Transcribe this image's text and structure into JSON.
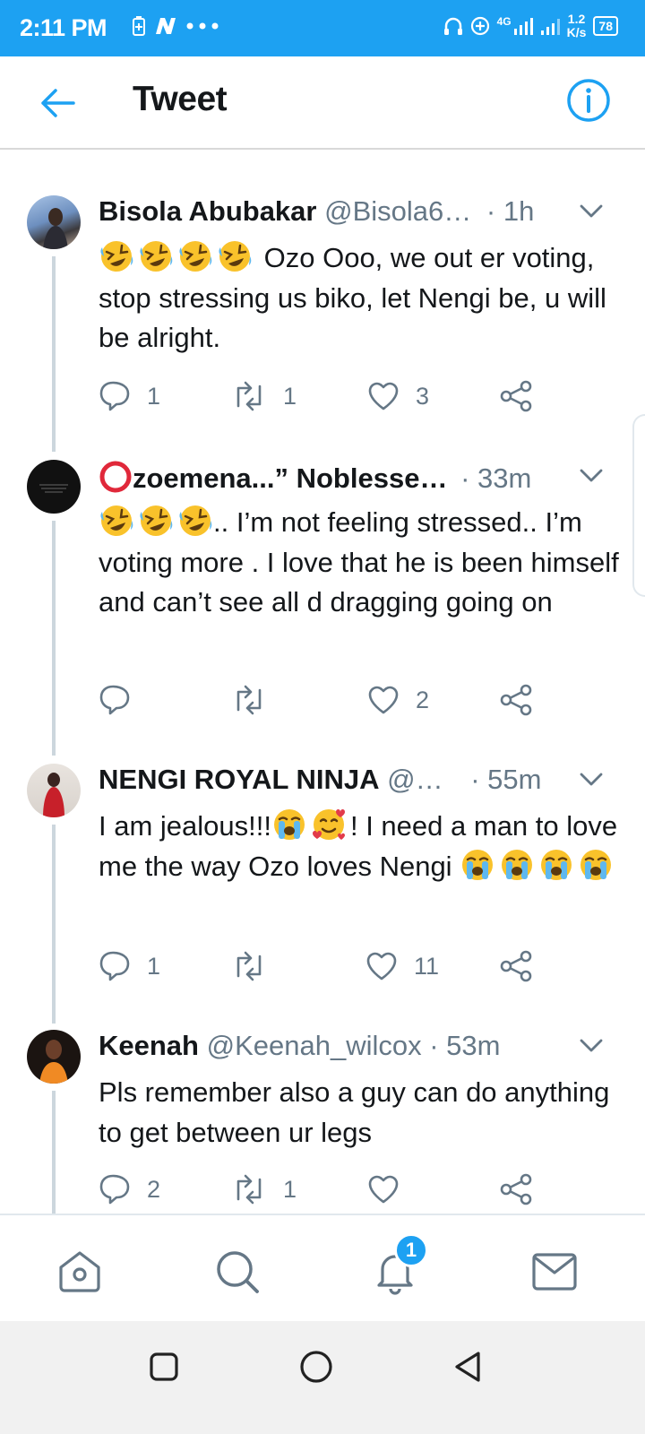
{
  "status_bar": {
    "time": "2:11 PM",
    "network": "4G",
    "speed_value": "1.2",
    "speed_unit": "K/s",
    "battery": "78"
  },
  "header": {
    "title": "Tweet"
  },
  "tweets": [
    {
      "name": "Bisola Abubakar",
      "handle": "@Bisola6…",
      "time": "· 1h",
      "emoji": [
        "rofl",
        "rofl",
        "rofl",
        "rofl"
      ],
      "text_line1": "Ozo Ooo, we out er",
      "text_rest": "voting, stop stressing us biko, let Nengi be, u will be alright.",
      "replies": "1",
      "retweets": "1",
      "likes": "3"
    },
    {
      "name_prefix": "⭕",
      "name": "zoemena...” Noblesse…",
      "handle": "",
      "time": "· 33m",
      "emoji": [
        "rofl",
        "rofl",
        "rofl"
      ],
      "text_line1": ".. I’m not feeling stressed..",
      "text_rest": "I’m voting more . I love that he is been himself and can’t see all d dragging going on",
      "replies": "",
      "retweets": "",
      "likes": "2"
    },
    {
      "name": "NENGI ROYAL NINJA",
      "handle": "@…",
      "time": "· 55m",
      "text_a": "I am jealous!!!",
      "text_b": "! I need a man to love me the way Ozo loves Nengi",
      "replies": "1",
      "retweets": "",
      "likes": "11"
    },
    {
      "name": "Keenah",
      "handle": "@Keenah_wilcox",
      "time": "· 53m",
      "text": "Pls remember also a guy can do anything to get between ur legs",
      "replies": "2",
      "retweets": "1",
      "likes": ""
    }
  ],
  "bottom_nav": {
    "items": [
      "home",
      "search",
      "notifications",
      "messages"
    ],
    "notification_badge": "1"
  },
  "colors": {
    "accent": "#1da1f2",
    "text": "#14171a",
    "muted": "#657786"
  }
}
